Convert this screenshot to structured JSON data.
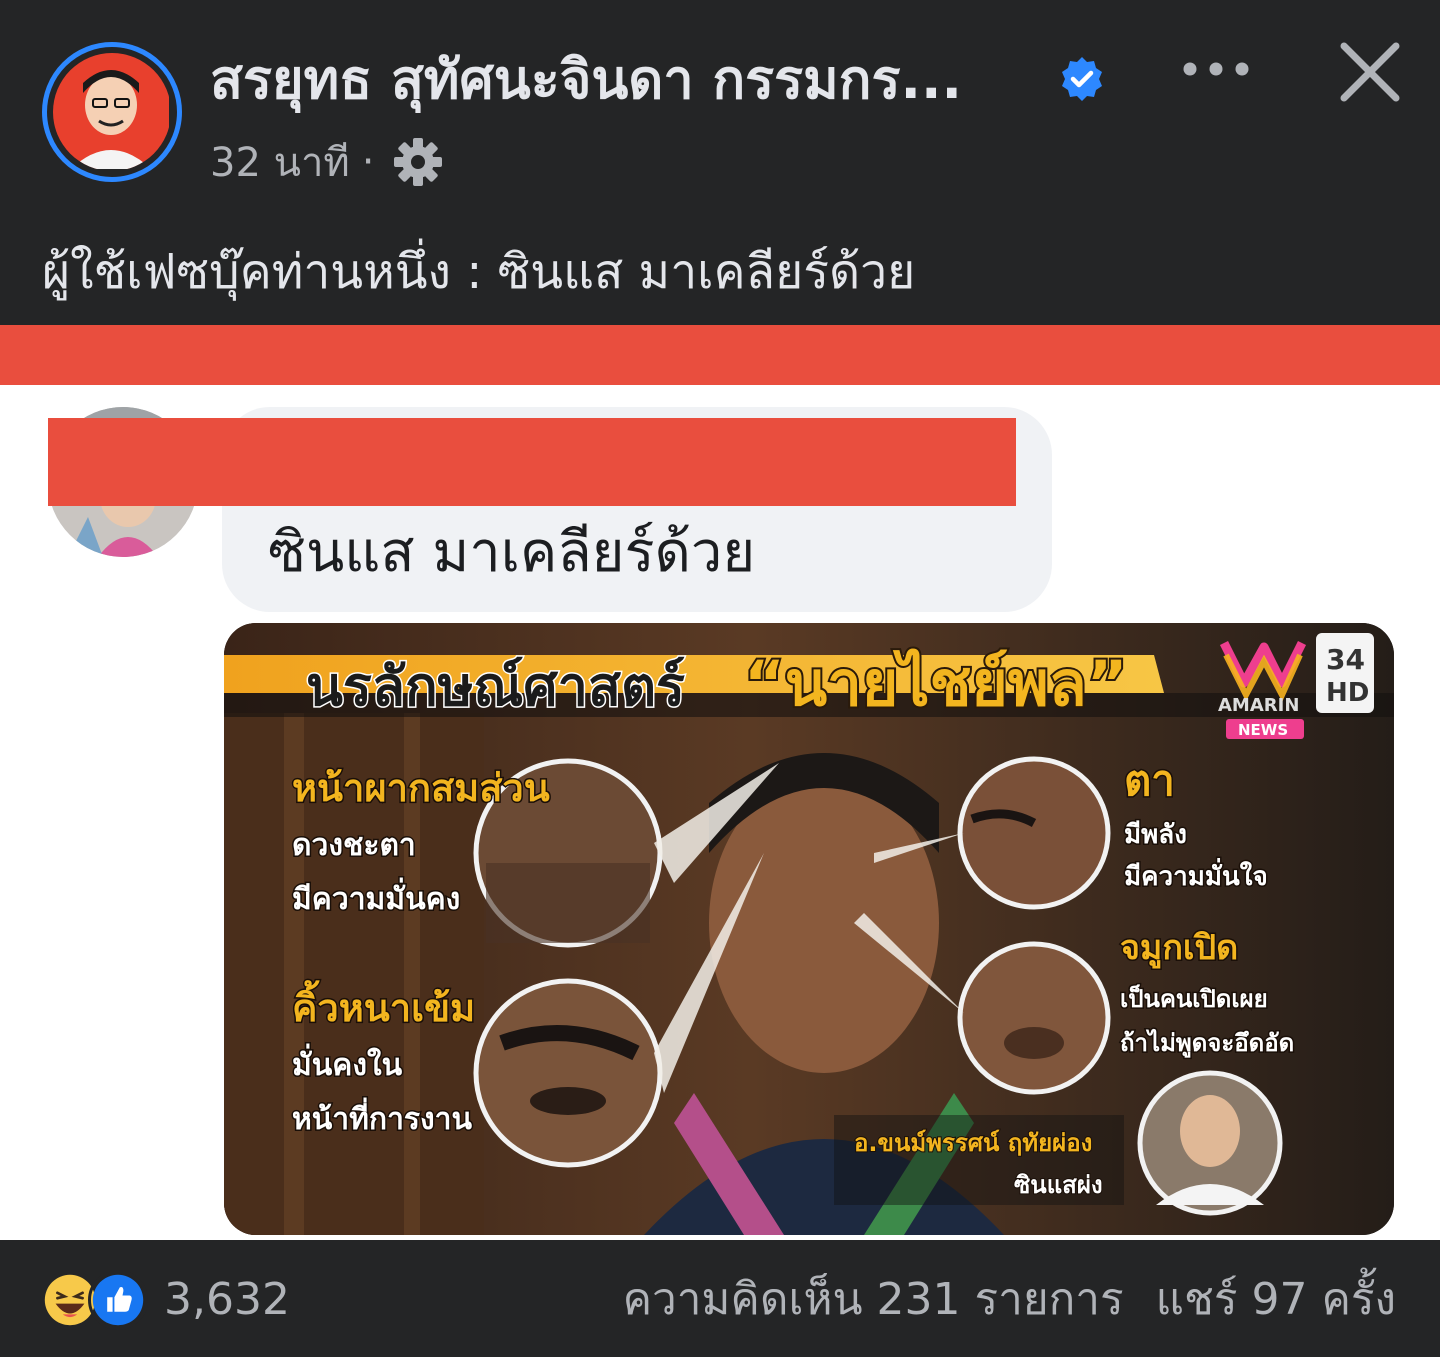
{
  "post": {
    "author_name": "สรยุทธ สุทัศนะจินดา กรรมกร...",
    "time": "32 นาที",
    "separator": "·",
    "caption": "ผู้ใช้เฟซบุ๊คท่านหนึ่ง : ซินแส มาเคลียร์ด้วย"
  },
  "icons": {
    "verified": "verified-badge-icon",
    "more": "more-options-icon",
    "close": "close-icon",
    "audience": "gear-icon",
    "react_haha": "haha-reaction-icon",
    "react_like": "like-reaction-icon"
  },
  "comment": {
    "text": "ซินแส มาเคลียร์ด้วย"
  },
  "news_image": {
    "title_left": "นรลักษณ์ศาสตร์",
    "title_right": "“นายไชย์พล”",
    "brand": "AMARIN",
    "brand_sub": "NEWS",
    "channel_num": "34",
    "channel_hd": "HD",
    "forehead_title": "หน้าผากสมส่วน",
    "forehead_line1": "ดวงชะตา",
    "forehead_line2": "มีความมั่นคง",
    "brow_title": "คิ้วหนาเข้ม",
    "brow_line1": "มั่นคงใน",
    "brow_line2": "หน้าที่การงาน",
    "eye_title": "ตา",
    "eye_line1": "มีพลัง",
    "eye_line2": "มีความมั่นใจ",
    "nose_title": "จมูกเปิด",
    "nose_line1": "เป็นคนเปิดเผย",
    "nose_line2": "ถ้าไม่พูดจะอึดอัด",
    "expert_name": "อ.ขนม์พรรศน์ ฤทัยผ่อง",
    "expert_role": "ซินแสผ่ง"
  },
  "footer": {
    "reaction_count": "3,632",
    "comments": "ความคิดเห็น 231 รายการ",
    "shares": "แชร์ 97 ครั้ง"
  },
  "colors": {
    "dark_bg": "#242526",
    "redaction": "#e94e3e",
    "verified_blue": "#2d88ff",
    "title_yellow": "#f3b51f"
  }
}
